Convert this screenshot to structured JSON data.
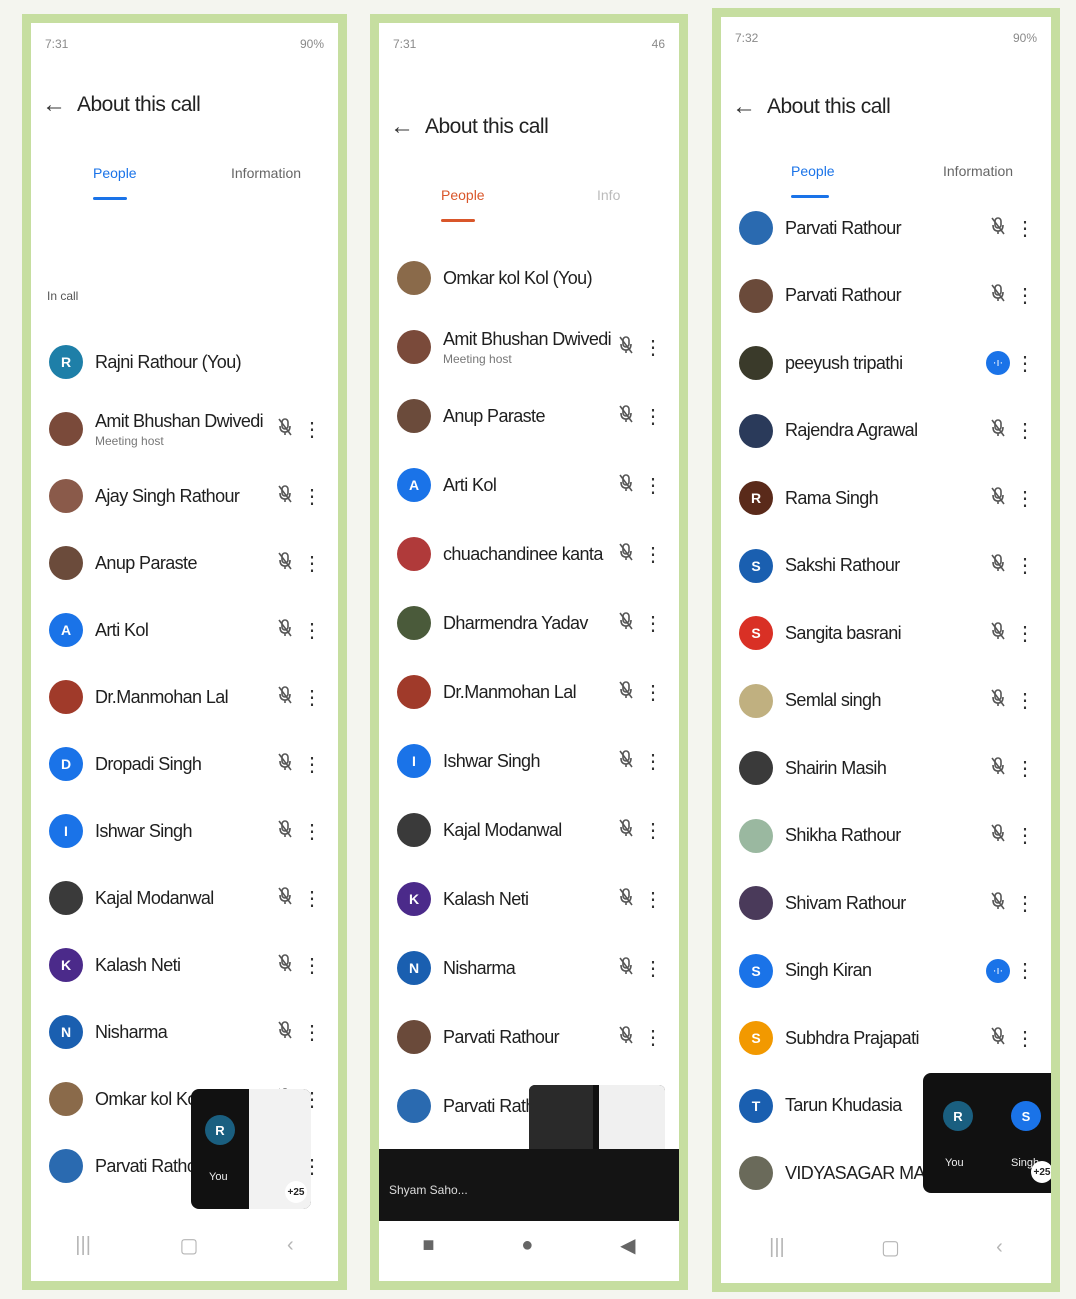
{
  "colors": {
    "accent": "#1a73e8",
    "border": "#c6dea0",
    "online": "#1e8e3e"
  },
  "screen1": {
    "status_time": "7:31",
    "status_right": "90%",
    "title": "About this call",
    "tab_people": "People",
    "tab_info": "Information",
    "section": "In call",
    "people": [
      {
        "name": "Rajni Rathour (You)",
        "initial": "R",
        "color": "#1e7fa8",
        "sub": ""
      },
      {
        "name": "Amit Bhushan Dwivedi",
        "initial": "",
        "color": "#7a4a3a",
        "sub": "Meeting host"
      },
      {
        "name": "Ajay Singh Rathour",
        "initial": "",
        "color": "#8a5a4a",
        "sub": ""
      },
      {
        "name": "Anup Paraste",
        "initial": "",
        "color": "#6b4b3b",
        "sub": ""
      },
      {
        "name": "Arti Kol",
        "initial": "A",
        "color": "#1a73e8",
        "sub": ""
      },
      {
        "name": "Dr.Manmohan Lal",
        "initial": "",
        "color": "#a03a2a",
        "sub": ""
      },
      {
        "name": "Dropadi Singh",
        "initial": "D",
        "color": "#1a73e8",
        "sub": ""
      },
      {
        "name": "Ishwar Singh",
        "initial": "I",
        "color": "#1a73e8",
        "sub": ""
      },
      {
        "name": "Kajal Modanwal",
        "initial": "",
        "color": "#3a3a3a",
        "sub": ""
      },
      {
        "name": "Kalash Neti",
        "initial": "K",
        "color": "#4b2a8a",
        "sub": ""
      },
      {
        "name": "Nisharma",
        "initial": "N",
        "color": "#1a5fb0",
        "sub": ""
      },
      {
        "name": "Omkar kol Kol",
        "initial": "",
        "color": "#8a6a4a",
        "sub": ""
      },
      {
        "name": "Parvati Rathour",
        "initial": "",
        "color": "#2a6ab0",
        "sub": ""
      }
    ],
    "pip_you": "You",
    "pip_badge": "+25"
  },
  "screen2": {
    "status_time": "7:31",
    "status_right": "46",
    "title": "About this call",
    "tab_people": "People",
    "tab_info": "Info",
    "people": [
      {
        "name": "Omkar kol Kol (You)",
        "initial": "",
        "color": "#8a6a4a",
        "sub": ""
      },
      {
        "name": "Amit Bhushan Dwivedi",
        "initial": "",
        "color": "#7a4a3a",
        "sub": "Meeting host"
      },
      {
        "name": "Anup Paraste",
        "initial": "",
        "color": "#6b4b3b",
        "sub": ""
      },
      {
        "name": "Arti Kol",
        "initial": "A",
        "color": "#1a73e8",
        "sub": ""
      },
      {
        "name": "chuachandinee kanta",
        "initial": "",
        "color": "#b03a3a",
        "sub": ""
      },
      {
        "name": "Dharmendra Yadav",
        "initial": "",
        "color": "#4a5a3a",
        "sub": ""
      },
      {
        "name": "Dr.Manmohan Lal",
        "initial": "",
        "color": "#a03a2a",
        "sub": ""
      },
      {
        "name": "Ishwar Singh",
        "initial": "I",
        "color": "#1a73e8",
        "sub": ""
      },
      {
        "name": "Kajal Modanwal",
        "initial": "",
        "color": "#3a3a3a",
        "sub": ""
      },
      {
        "name": "Kalash Neti",
        "initial": "K",
        "color": "#4b2a8a",
        "sub": ""
      },
      {
        "name": "Nisharma",
        "initial": "N",
        "color": "#1a5fb0",
        "sub": ""
      },
      {
        "name": "Parvati Rathour",
        "initial": "",
        "color": "#6a4a3a",
        "sub": ""
      },
      {
        "name": "Parvati Rathour",
        "initial": "",
        "color": "#2a6ab0",
        "sub": ""
      }
    ],
    "caption": "Shyam Saho..."
  },
  "screen3": {
    "status_time": "7:32",
    "status_right": "90%",
    "title": "About this call",
    "tab_people": "People",
    "tab_info": "Information",
    "people": [
      {
        "name": "Parvati Rathour",
        "initial": "",
        "color": "#2a6ab0",
        "speaking": false
      },
      {
        "name": "Parvati Rathour",
        "initial": "",
        "color": "#6a4a3a",
        "speaking": false
      },
      {
        "name": "peeyush tripathi",
        "initial": "",
        "color": "#3a3a2a",
        "speaking": true
      },
      {
        "name": "Rajendra Agrawal",
        "initial": "",
        "color": "#2a3a5a",
        "speaking": false
      },
      {
        "name": "Rama Singh",
        "initial": "R",
        "color": "#5a2a1a",
        "speaking": false
      },
      {
        "name": "Sakshi Rathour",
        "initial": "S",
        "color": "#1a5fb0",
        "speaking": false
      },
      {
        "name": "Sangita basrani",
        "initial": "S",
        "color": "#d93025",
        "speaking": false
      },
      {
        "name": "Semlal singh",
        "initial": "",
        "color": "#c0b080",
        "speaking": false
      },
      {
        "name": "Shairin Masih",
        "initial": "",
        "color": "#3a3a3a",
        "speaking": false
      },
      {
        "name": "Shikha Rathour",
        "initial": "",
        "color": "#9ab8a0",
        "speaking": false
      },
      {
        "name": "Shivam Rathour",
        "initial": "",
        "color": "#4a3a5a",
        "speaking": false
      },
      {
        "name": "Singh Kiran",
        "initial": "S",
        "color": "#1a73e8",
        "speaking": true
      },
      {
        "name": "Subhdra Prajapati",
        "initial": "S",
        "color": "#f29900",
        "speaking": false
      },
      {
        "name": "Tarun Khudasia",
        "initial": "T",
        "color": "#1a5fb0",
        "speaking": false
      },
      {
        "name": "VIDYASAGAR MAJHI",
        "initial": "",
        "color": "#6a6a5a",
        "speaking": false
      }
    ],
    "pip_you": "You",
    "pip_other": "Singh",
    "pip_badge": "+25"
  },
  "icons": {
    "back": "arrow-left-icon",
    "mute": "mic-off-icon",
    "more": "more-vert-icon"
  }
}
